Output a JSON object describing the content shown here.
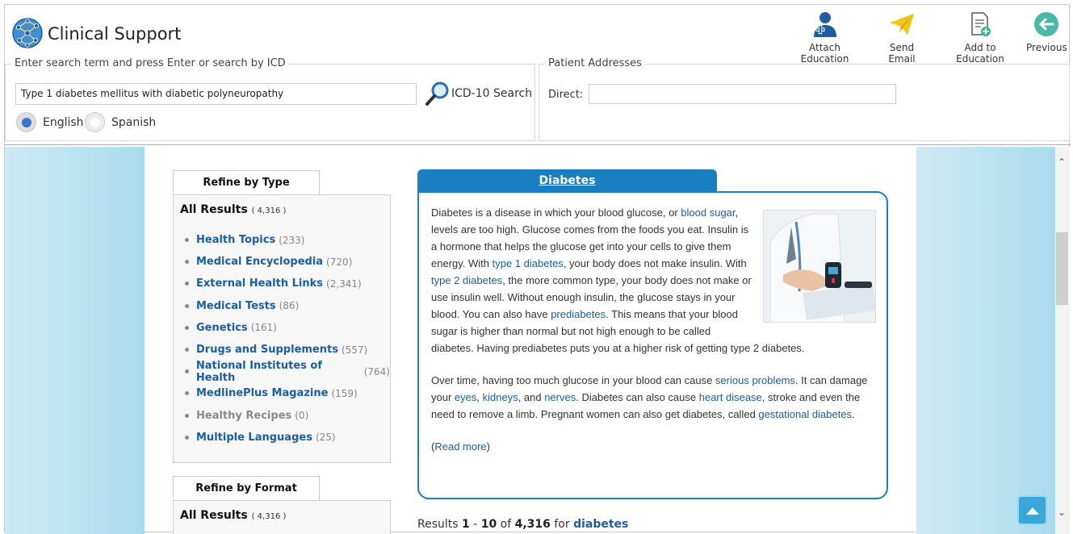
{
  "header": {
    "title": "Clinical Support",
    "toolbar": [
      {
        "label": "Attach Education",
        "icon": "doctor-icon"
      },
      {
        "label": "Send Email",
        "icon": "paper-plane-icon"
      },
      {
        "label": "Add to Education",
        "icon": "document-add-icon"
      },
      {
        "label": "Previous",
        "icon": "back-arrow-icon"
      }
    ]
  },
  "search": {
    "legend": "Enter search term and press Enter or search by ICD",
    "value": "Type 1 diabetes mellitus with diabetic polyneuropathy",
    "icd_label": "ICD-10 Search",
    "languages": [
      {
        "label": "English",
        "selected": true
      },
      {
        "label": "Spanish",
        "selected": false
      }
    ]
  },
  "patient": {
    "legend": "Patient Addresses",
    "direct_label": "Direct:",
    "direct_value": ""
  },
  "refine_type": {
    "tab": "Refine by Type",
    "all_results_label": "All Results",
    "all_results_count": "( 4,316 )",
    "categories": [
      {
        "name": "Health Topics",
        "count": "(233)",
        "muted": false
      },
      {
        "name": "Medical Encyclopedia",
        "count": "(720)",
        "muted": false
      },
      {
        "name": "External Health Links",
        "count": "(2,341)",
        "muted": false
      },
      {
        "name": "Medical Tests",
        "count": "(86)",
        "muted": false
      },
      {
        "name": "Genetics",
        "count": "(161)",
        "muted": false
      },
      {
        "name": "Drugs and Supplements",
        "count": "(557)",
        "muted": false
      },
      {
        "name": "National Institutes of Health",
        "count": "(764)",
        "muted": false
      },
      {
        "name": "MedlinePlus Magazine",
        "count": "(159)",
        "muted": false
      },
      {
        "name": "Healthy Recipes",
        "count": "(0)",
        "muted": true
      },
      {
        "name": "Multiple Languages",
        "count": "(25)",
        "muted": false
      }
    ]
  },
  "refine_format": {
    "tab": "Refine by Format",
    "all_results_label": "All Results",
    "all_results_count": "( 4,316 )"
  },
  "topic": {
    "title": "Diabetes",
    "p1": [
      {
        "t": "Diabetes is a disease in which your blood glucose, or "
      },
      {
        "t": "blood sugar",
        "link": true
      },
      {
        "t": ", levels are too high. Glucose comes from the foods you eat. Insulin is a hormone that helps the glucose get into your cells to give them energy. With "
      },
      {
        "t": "type 1 diabetes",
        "link": true
      },
      {
        "t": ", your body does not make insulin. With "
      },
      {
        "t": "type 2 diabetes",
        "link": true
      },
      {
        "t": ", the more common type, your body does not make or use insulin well. Without enough insulin, the glucose stays in your blood. You can also have "
      },
      {
        "t": "prediabetes",
        "link": true
      },
      {
        "t": ". This means that your blood sugar is higher than normal but not high enough to be called diabetes. Having prediabetes puts you at a higher risk of getting type 2 diabetes."
      }
    ],
    "p2": [
      {
        "t": "Over time, having too much glucose in your blood can cause "
      },
      {
        "t": "serious problems",
        "link": true
      },
      {
        "t": ". It can damage your "
      },
      {
        "t": "eyes",
        "link": true
      },
      {
        "t": ", "
      },
      {
        "t": "kidneys",
        "link": true
      },
      {
        "t": ", and "
      },
      {
        "t": "nerves",
        "link": true
      },
      {
        "t": ". Diabetes can also cause "
      },
      {
        "t": "heart disease",
        "link": true
      },
      {
        "t": ", stroke and even the need to remove a limb. Pregnant women can also get diabetes, called "
      },
      {
        "t": "gestational diabetes",
        "link": true
      },
      {
        "t": "."
      }
    ],
    "read_more_open": "(",
    "read_more": "Read more",
    "read_more_close": ")"
  },
  "results": {
    "prefix": "Results ",
    "from": "1",
    "dash": " - ",
    "to": "10",
    "of": " of ",
    "total": "4,316",
    "for": " for ",
    "query": "diabetes"
  },
  "colors": {
    "accent": "#1a7fc0",
    "link": "#1b5ea3"
  }
}
